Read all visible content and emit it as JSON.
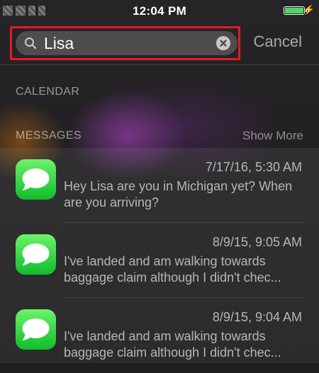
{
  "status_bar": {
    "time": "12:04 PM",
    "battery_level": 1.0,
    "charging_icon": "bolt-icon"
  },
  "search": {
    "value": "Lisa",
    "cancel_label": "Cancel",
    "highlight_color": "#e21b26"
  },
  "sections": {
    "calendar_label": "CALENDAR",
    "messages_label": "MESSAGES",
    "show_more_label": "Show More"
  },
  "messages": [
    {
      "icon": "messages-app-icon",
      "date": "7/17/16, 5:30 AM",
      "line1": "Hey Lisa are you in Michigan yet? When",
      "line2": "are you arriving?"
    },
    {
      "icon": "messages-app-icon",
      "date": "8/9/15, 9:05 AM",
      "line1": "I've landed and am walking towards",
      "line2": "baggage claim although I didn't chec..."
    },
    {
      "icon": "messages-app-icon",
      "date": "8/9/15, 9:04 AM",
      "line1": "I've landed and am walking towards",
      "line2": "baggage claim although I didn't chec..."
    }
  ],
  "colors": {
    "messages_green": "#1fcf3c",
    "battery_green": "#4cd964"
  }
}
